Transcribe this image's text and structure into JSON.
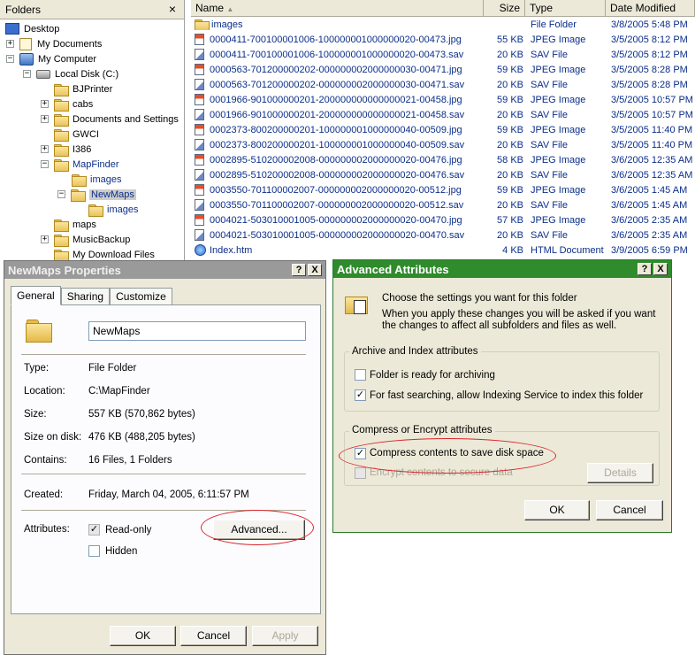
{
  "folders_pane": {
    "title": "Folders",
    "close": "×",
    "items": [
      {
        "label": "Desktop"
      },
      {
        "label": "My Documents"
      },
      {
        "label": "My Computer"
      },
      {
        "label": "Local Disk (C:)"
      },
      {
        "label": "BJPrinter"
      },
      {
        "label": "cabs"
      },
      {
        "label": "Documents and Settings"
      },
      {
        "label": "GWCI"
      },
      {
        "label": "I386"
      },
      {
        "label": "MapFinder"
      },
      {
        "label": "images"
      },
      {
        "label": "NewMaps"
      },
      {
        "label": "images"
      },
      {
        "label": "maps"
      },
      {
        "label": "MusicBackup"
      },
      {
        "label": "My Download Files"
      }
    ]
  },
  "file_list": {
    "columns": [
      "Name",
      "Size",
      "Type",
      "Date Modified"
    ],
    "rows": [
      {
        "name": "images",
        "size": "",
        "type": "File Folder",
        "date": "3/8/2005 5:48 PM",
        "icon": "folder-icon"
      },
      {
        "name": "0000411-700100001006-100000001000000020-00473.jpg",
        "size": "55 KB",
        "type": "JPEG Image",
        "date": "3/5/2005 8:12 PM",
        "icon": "jpg-icon"
      },
      {
        "name": "0000411-700100001006-100000001000000020-00473.sav",
        "size": "20 KB",
        "type": "SAV File",
        "date": "3/5/2005 8:12 PM",
        "icon": "sav-icon"
      },
      {
        "name": "0000563-701200000202-000000002000000030-00471.jpg",
        "size": "59 KB",
        "type": "JPEG Image",
        "date": "3/5/2005 8:28 PM",
        "icon": "jpg-icon"
      },
      {
        "name": "0000563-701200000202-000000002000000030-00471.sav",
        "size": "20 KB",
        "type": "SAV File",
        "date": "3/5/2005 8:28 PM",
        "icon": "sav-icon"
      },
      {
        "name": "0001966-901000000201-200000000000000021-00458.jpg",
        "size": "59 KB",
        "type": "JPEG Image",
        "date": "3/5/2005 10:57 PM",
        "icon": "jpg-icon"
      },
      {
        "name": "0001966-901000000201-200000000000000021-00458.sav",
        "size": "20 KB",
        "type": "SAV File",
        "date": "3/5/2005 10:57 PM",
        "icon": "sav-icon"
      },
      {
        "name": "0002373-800200000201-100000001000000040-00509.jpg",
        "size": "59 KB",
        "type": "JPEG Image",
        "date": "3/5/2005 11:40 PM",
        "icon": "jpg-icon"
      },
      {
        "name": "0002373-800200000201-100000001000000040-00509.sav",
        "size": "20 KB",
        "type": "SAV File",
        "date": "3/5/2005 11:40 PM",
        "icon": "sav-icon"
      },
      {
        "name": "0002895-510200002008-000000002000000020-00476.jpg",
        "size": "58 KB",
        "type": "JPEG Image",
        "date": "3/6/2005 12:35 AM",
        "icon": "jpg-icon"
      },
      {
        "name": "0002895-510200002008-000000002000000020-00476.sav",
        "size": "20 KB",
        "type": "SAV File",
        "date": "3/6/2005 12:35 AM",
        "icon": "sav-icon"
      },
      {
        "name": "0003550-701100002007-000000002000000020-00512.jpg",
        "size": "59 KB",
        "type": "JPEG Image",
        "date": "3/6/2005 1:45 AM",
        "icon": "jpg-icon"
      },
      {
        "name": "0003550-701100002007-000000002000000020-00512.sav",
        "size": "20 KB",
        "type": "SAV File",
        "date": "3/6/2005 1:45 AM",
        "icon": "sav-icon"
      },
      {
        "name": "0004021-503010001005-000000002000000020-00470.jpg",
        "size": "57 KB",
        "type": "JPEG Image",
        "date": "3/6/2005 2:35 AM",
        "icon": "jpg-icon"
      },
      {
        "name": "0004021-503010001005-000000002000000020-00470.sav",
        "size": "20 KB",
        "type": "SAV File",
        "date": "3/6/2005 2:35 AM",
        "icon": "sav-icon"
      },
      {
        "name": "Index.htm",
        "size": "4 KB",
        "type": "HTML Document",
        "date": "3/9/2005 6:59 PM",
        "icon": "html-icon"
      }
    ]
  },
  "properties": {
    "title": "NewMaps Properties",
    "help": "?",
    "close": "X",
    "tabs": [
      "General",
      "Sharing",
      "Customize"
    ],
    "folder_name": "NewMaps",
    "fields": [
      {
        "label": "Type:",
        "value": "File Folder"
      },
      {
        "label": "Location:",
        "value": "C:\\MapFinder"
      },
      {
        "label": "Size:",
        "value": "557 KB (570,862 bytes)"
      },
      {
        "label": "Size on disk:",
        "value": "476 KB (488,205 bytes)"
      },
      {
        "label": "Contains:",
        "value": "16 Files, 1 Folders"
      },
      {
        "label": "Created:",
        "value": "Friday, March 04, 2005, 6:11:57 PM"
      }
    ],
    "attributes_label": "Attributes:",
    "readonly_label": "Read-only",
    "readonly_checked": "✓",
    "hidden_label": "Hidden",
    "advanced_button": "Advanced...",
    "ok": "OK",
    "cancel": "Cancel",
    "apply": "Apply"
  },
  "advanced": {
    "title": "Advanced Attributes",
    "help": "?",
    "close": "X",
    "intro": "Choose the settings you want for this folder",
    "note": "When you apply these changes you will be asked if you want the changes to affect all subfolders and files as well.",
    "group1_title": "Archive and Index attributes",
    "archive_label": "Folder is ready for archiving",
    "index_label": "For fast searching, allow Indexing Service to index this folder",
    "index_checked": "✓",
    "group2_title": "Compress or Encrypt attributes",
    "compress_label": "Compress contents to save disk space",
    "compress_checked": "✓",
    "encrypt_label": "Encrypt contents to secure data",
    "details_button": "Details",
    "ok": "OK",
    "cancel": "Cancel"
  },
  "colors": {
    "adv_title": "#2f8b2c",
    "props_title": "#9a9a9a",
    "highlight_oval": "#d9262b",
    "link_text": "#0b2e8a"
  }
}
